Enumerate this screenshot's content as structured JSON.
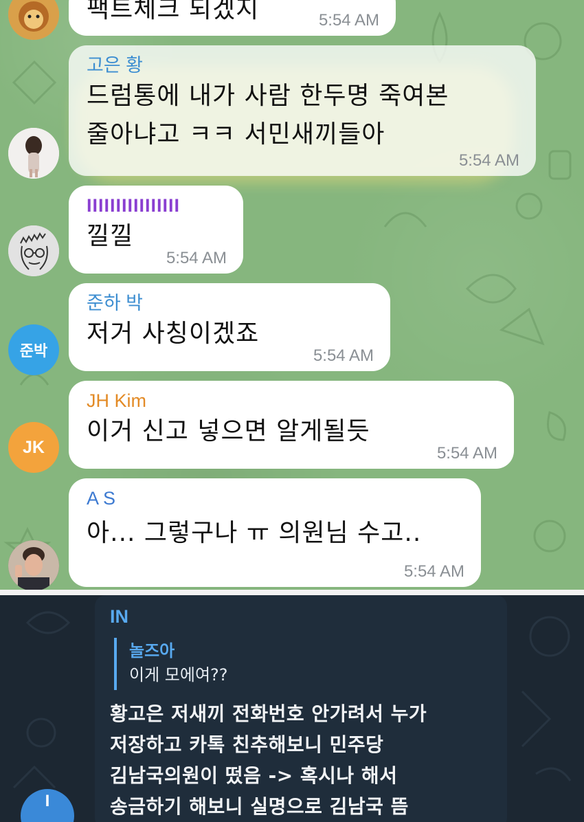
{
  "light_chat": {
    "messages": [
      {
        "sender": "",
        "text_lines": [
          "팩트체크 되겠지"
        ],
        "time": "5:54 AM",
        "avatar_icon": "lion-cartoon-icon"
      },
      {
        "sender": "고은 황",
        "sender_color": "#3d8ed1",
        "text_lines": [
          "드럼통에 내가 사람 한두명 죽여본",
          "줄아냐고 ㅋㅋ 서민새끼들아"
        ],
        "time": "5:54 AM",
        "highlighted": true,
        "avatar_icon": "person-photo-icon"
      },
      {
        "sender_bar": "IIIIIIIIIIIIIIII",
        "sender_color": "#8a3fd1",
        "text_lines": [
          "낄낄"
        ],
        "time": "5:54 AM",
        "avatar_icon": "face-sketch-icon"
      },
      {
        "sender": "준하 박",
        "sender_color": "#3d8ed1",
        "text_lines": [
          "저거 사칭이겠죠"
        ],
        "time": "5:54 AM",
        "avatar_text": "준박",
        "avatar_color": "#36a3e6"
      },
      {
        "sender": "JH Kim",
        "sender_color": "#e38b27",
        "text_lines": [
          "이거 신고 넣으면 알게될듯"
        ],
        "time": "5:54 AM",
        "avatar_text": "JK",
        "avatar_color": "#f3a33c"
      },
      {
        "sender": "A S",
        "sender_color": "#3d7ad1",
        "text_lines": [
          "아... 그렇구나 ㅠ 의원님 수고.."
        ],
        "time": "5:54 AM",
        "avatar_icon": "man-photo-icon"
      }
    ]
  },
  "dark_chat": {
    "sender": "IN",
    "sender_color": "#58a9ef",
    "quote": {
      "name": "놀즈아",
      "text": "이게 모에여??"
    },
    "body_lines": [
      "황고은 저새끼 전화번호 안가려서 누가",
      "저장하고 카톡 친추해보니 민주당",
      "김남국의원이 떴음 -> 혹시나 해서",
      "송금하기 해보니 실명으로 김남국 뜸"
    ],
    "avatar_text": "I",
    "avatar_color": "#3a89d8"
  }
}
